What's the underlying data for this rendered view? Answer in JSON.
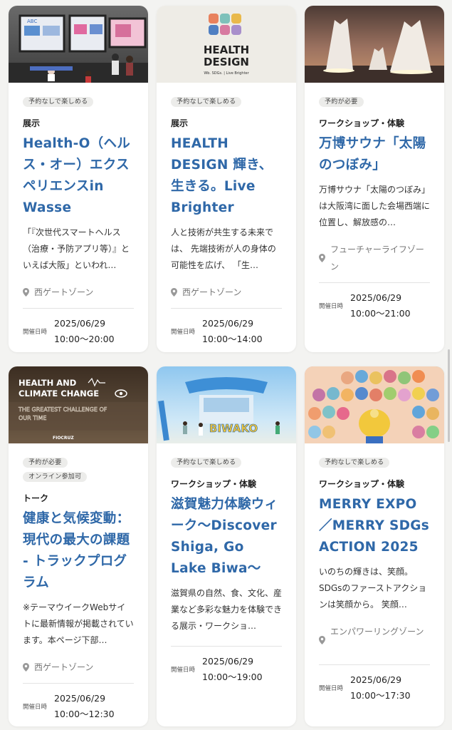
{
  "cards": [
    {
      "badges": [
        "予約なしで楽しめる"
      ],
      "category": "展示",
      "title": "Health-O（ヘルス・オー）エクスペリエンスin Wasse",
      "desc": "「『次世代スマートヘルス（治療・予防アプリ等）』といえば大阪」といわれ…",
      "location": "西ゲートゾーン",
      "date_label": "開催日時",
      "date": "2025/06/29",
      "time": "10:00～20:00",
      "image": {
        "signage": "ABC"
      }
    },
    {
      "badges": [
        "予約なしで楽しめる"
      ],
      "category": "展示",
      "title": "HEALTH DESIGN 輝き、生きる。Live Brighter",
      "desc": "人と技術が共生する未来では、 先端技術が人の身体の可能性を広げ、 「生…",
      "location": "西ゲートゾーン",
      "date_label": "開催日時",
      "date": "2025/06/29",
      "time": "10:00～14:00",
      "image": {
        "logo_line1": "HEALTH",
        "logo_line2": "DESIGN",
        "logo_sub": "Wb. SDGs. | Live Brighter"
      }
    },
    {
      "badges": [
        "予約が必要"
      ],
      "category": "ワークショップ・体験",
      "title": "万博サウナ「太陽のつぼみ」",
      "desc": "万博サウナ「太陽のつぼみ」は大阪湾に面した会場西端に位置し、解放感の…",
      "location": "フューチャーライフゾーン",
      "date_label": "開催日時",
      "date": "2025/06/29",
      "time": "10:00～21:00",
      "image": {}
    },
    {
      "badges": [
        "予約が必要",
        "オンライン参加可"
      ],
      "category": "トーク",
      "title": "健康と気候変動：現代の最大の課題 - トラックプログラム",
      "desc": "※テーマウイークWebサイトに最新情報が掲載されています。本ページ下部…",
      "location": "西ゲートゾーン",
      "date_label": "開催日時",
      "date": "2025/06/29",
      "time": "10:00～12:30",
      "image": {
        "line1": "HEALTH AND",
        "line2": "CLIMATE CHANGE",
        "line3": "THE GREATEST CHALLENGE OF",
        "line4": "OUR TIME",
        "footer": "FIOCRUZ"
      }
    },
    {
      "badges": [
        "予約なしで楽しめる"
      ],
      "category": "ワークショップ・体験",
      "title": "滋賀魅力体験ウィーク～Discover Shiga, Go Lake Biwa～",
      "desc": "滋賀県の自然、食、文化、産業など多彩な魅力を体験できる展示・ワークショ…",
      "location": "",
      "date_label": "開催日時",
      "date": "2025/06/29",
      "time": "10:00～19:00",
      "image": {
        "sign": "BIWAKO"
      }
    },
    {
      "badges": [
        "予約なしで楽しめる"
      ],
      "category": "ワークショップ・体験",
      "title": "MERRY EXPO／MERRY SDGs ACTION 2025",
      "desc": "いのちの輝きは、笑顔。SDGsのファーストアクションは笑顔から。 笑顔…",
      "location": "エンパワーリングゾーン",
      "date_label": "開催日時",
      "date": "2025/06/29",
      "time": "10:00～17:30",
      "image": {}
    }
  ]
}
